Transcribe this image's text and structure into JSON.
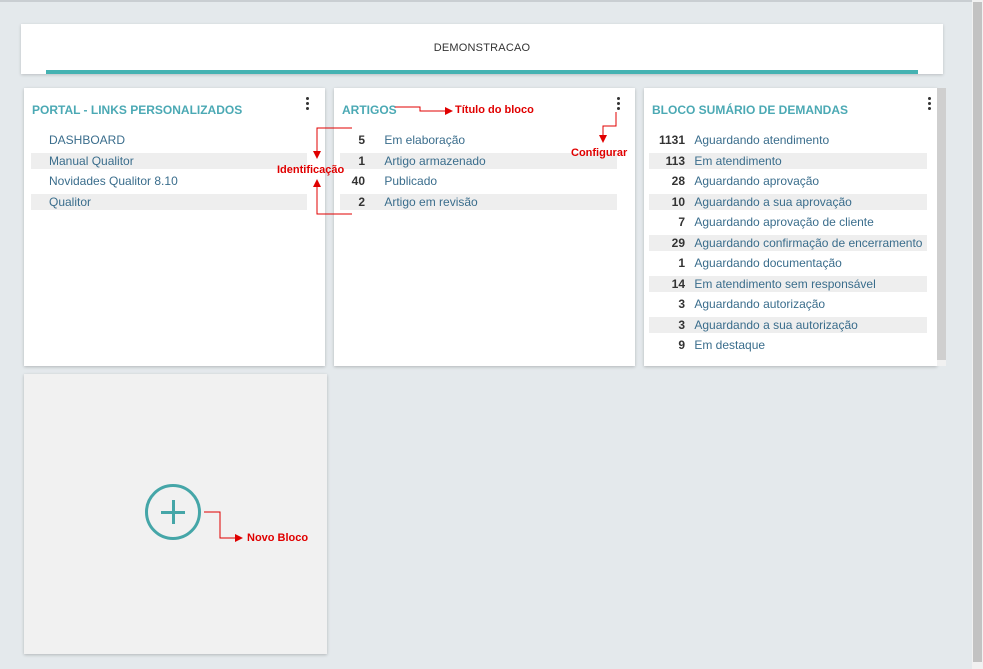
{
  "header": {
    "title": "DEMONSTRACAO"
  },
  "cards": [
    {
      "title": "PORTAL - LINKS PERSONALIZADOS",
      "items": [
        {
          "label": "DASHBOARD"
        },
        {
          "label": "Manual Qualitor"
        },
        {
          "label": "Novidades Qualitor 8.10"
        },
        {
          "label": "Qualitor"
        }
      ]
    },
    {
      "title": "ARTIGOS",
      "items": [
        {
          "count": "5",
          "label": "Em elaboração"
        },
        {
          "count": "1",
          "label": "Artigo armazenado"
        },
        {
          "count": "40",
          "label": "Publicado"
        },
        {
          "count": "2",
          "label": "Artigo em revisão"
        }
      ]
    },
    {
      "title": "BLOCO SUMÁRIO DE DEMANDAS",
      "items": [
        {
          "count": "1131",
          "label": "Aguardando atendimento"
        },
        {
          "count": "113",
          "label": "Em atendimento"
        },
        {
          "count": "28",
          "label": "Aguardando aprovação"
        },
        {
          "count": "10",
          "label": "Aguardando a sua aprovação"
        },
        {
          "count": "7",
          "label": "Aguardando aprovação de cliente"
        },
        {
          "count": "29",
          "label": "Aguardando confirmação de encerramento"
        },
        {
          "count": "1",
          "label": "Aguardando documentação"
        },
        {
          "count": "14",
          "label": "Em atendimento sem responsável"
        },
        {
          "count": "3",
          "label": "Aguardando autorização"
        },
        {
          "count": "3",
          "label": "Aguardando a sua autorização"
        },
        {
          "count": "9",
          "label": "Em destaque"
        }
      ]
    }
  ],
  "annotations": {
    "block_title": "Título do bloco",
    "configure": "Configurar",
    "identification": "Identificação",
    "new_block": "Novo Bloco"
  },
  "colors": {
    "accent": "#45b2b2",
    "card_title": "#4ba9b4",
    "link": "#3a6d8c",
    "annotation": "#e00000"
  }
}
